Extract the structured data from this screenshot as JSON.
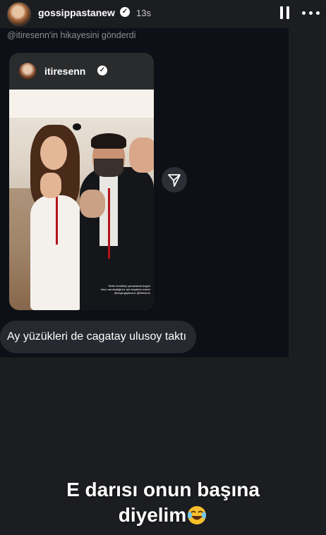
{
  "header": {
    "username": "gossippastanew",
    "time": "13s",
    "pause_icon": "pause-icon",
    "more_icon": "more-icon"
  },
  "dm": {
    "shared_label": "@itiresenn'in hikayesini gönderdi",
    "story_card": {
      "username": "itiresenn",
      "caption_lines": [
        "Sizler kendileyi yanaslarda bugün",
        "hücü nerdeşttiğinüz için teşekkür ederiz",
        "@engingaykuzun @itiresenn"
      ]
    },
    "message": "Ay yüzükleri de cagatay ulusoy taktı"
  },
  "overlay": {
    "line1": "E darısı onun başına",
    "line2": "diyelim",
    "emoji": "😂"
  }
}
